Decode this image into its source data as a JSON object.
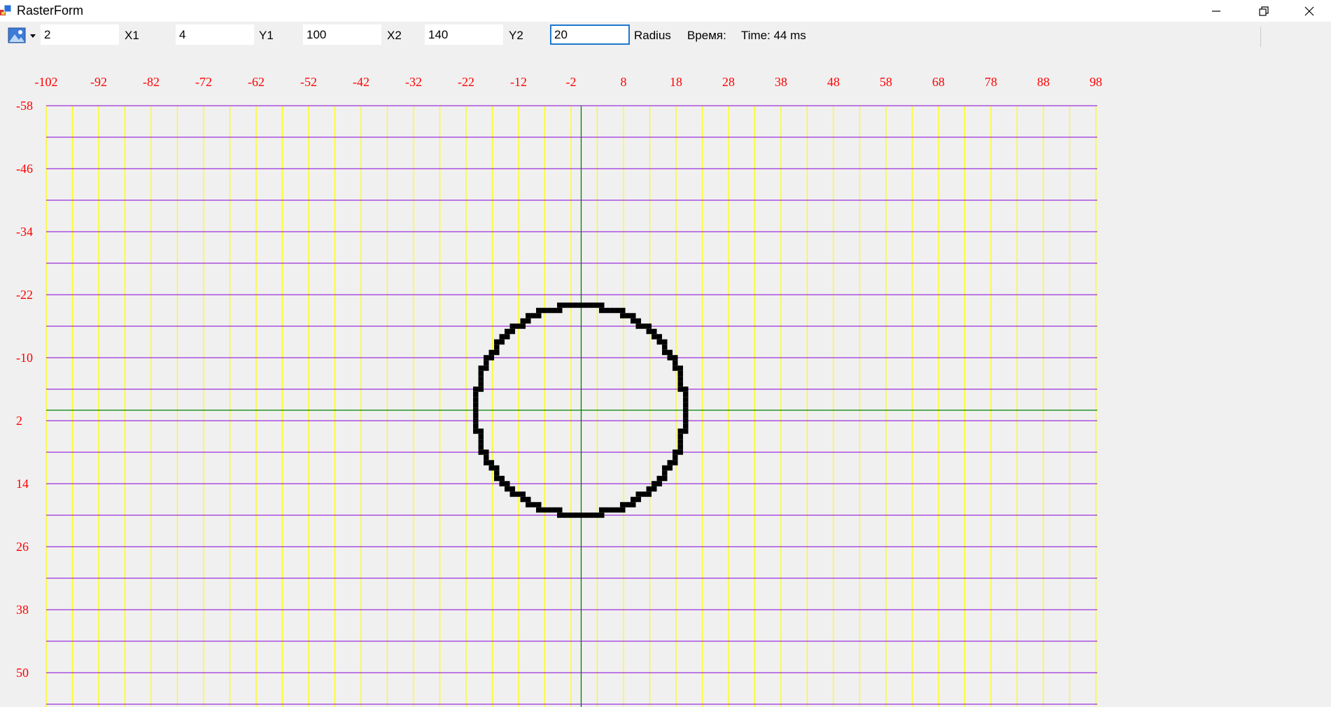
{
  "window": {
    "title": "RasterForm"
  },
  "toolbar": {
    "fields": [
      {
        "value": "2"
      },
      {
        "label": "X1",
        "value": "4"
      },
      {
        "label": "Y1",
        "value": "100"
      },
      {
        "label": "X2",
        "value": "140"
      },
      {
        "label": "Y2",
        "value": "20"
      }
    ],
    "radius_label": "Radius",
    "time_label": "Время:",
    "time_value": "Time: 44 ms"
  },
  "chart_data": {
    "type": "scatter",
    "x_tick_labels": [
      "-102",
      "-92",
      "-82",
      "-72",
      "-62",
      "-52",
      "-42",
      "-32",
      "-22",
      "-12",
      "-2",
      "8",
      "18",
      "28",
      "38",
      "48",
      "58",
      "68",
      "78",
      "88",
      "98"
    ],
    "y_tick_labels": [
      "-58",
      "-46",
      "-34",
      "-22",
      "-10",
      "2",
      "14",
      "26",
      "38",
      "50"
    ],
    "xlim": [
      -102,
      98
    ],
    "ylim": [
      -58,
      56
    ],
    "grid": true,
    "axes_origin": [
      0,
      0
    ],
    "circle": {
      "center": [
        0,
        0
      ],
      "radius": 20
    },
    "colors": {
      "vertical_grid": "#ffff00",
      "horizontal_grid": "#9b30d9",
      "axis": "#008000",
      "tick_labels": "#ff0000",
      "pixels": "#000000"
    }
  }
}
